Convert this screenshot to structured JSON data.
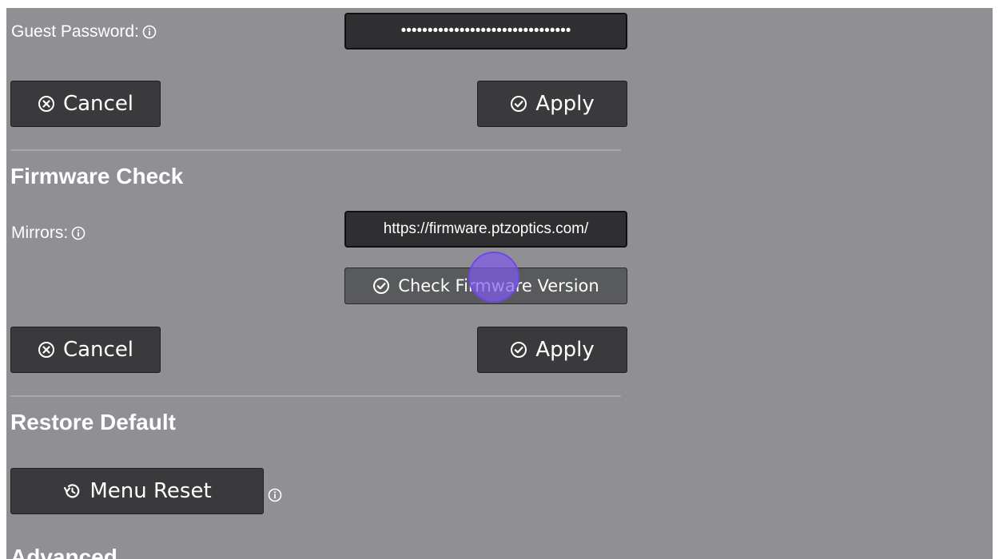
{
  "guest_password": {
    "label": "Guest Password:",
    "value": "••••••••••••••••••••••••••••••••"
  },
  "section1_buttons": {
    "cancel_label": "Cancel",
    "apply_label": "Apply"
  },
  "firmware_check": {
    "heading": "Firmware Check",
    "mirrors_label": "Mirrors:",
    "mirrors_value": "https://firmware.ptzoptics.com/",
    "check_button_label": "Check Firmware Version",
    "cancel_label": "Cancel",
    "apply_label": "Apply"
  },
  "restore_default": {
    "heading": "Restore Default",
    "menu_reset_label": "Menu Reset"
  },
  "advanced": {
    "heading": "Advanced"
  },
  "colors": {
    "panel_bg": "#909094",
    "button_bg": "#3a3a3c",
    "cursor": "#8a5cf0"
  },
  "icons": [
    "info-icon",
    "cancel-circle-x-icon",
    "check-circle-icon",
    "history-reset-icon"
  ]
}
